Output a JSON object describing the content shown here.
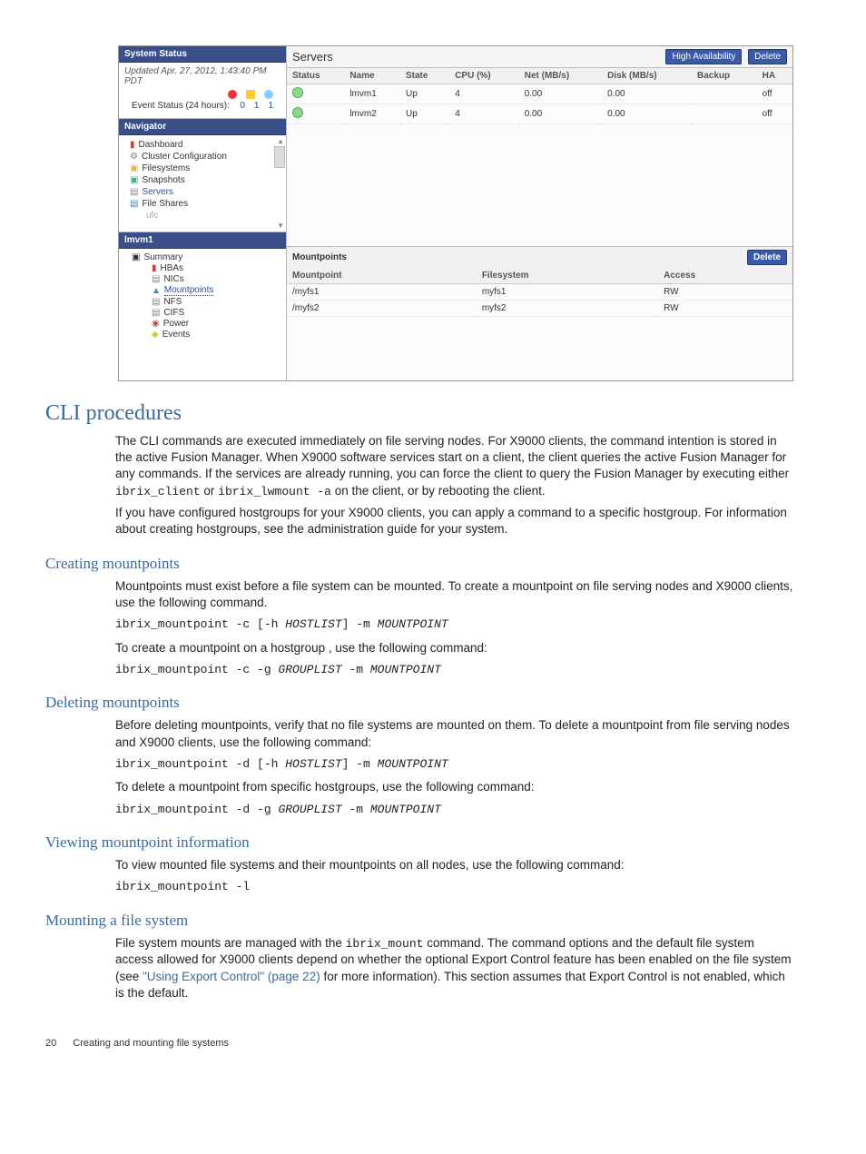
{
  "screenshot": {
    "system_status": {
      "title": "System Status",
      "updated": "Updated Apr. 27, 2012, 1:43:40 PM PDT",
      "event_label": "Event Status (24 hours):",
      "counts": [
        "0",
        "1",
        "1"
      ]
    },
    "navigator": {
      "title": "Navigator",
      "items": [
        "Dashboard",
        "Cluster Configuration",
        "Filesystems",
        "Snapshots",
        "Servers",
        "File Shares",
        "ufc"
      ]
    },
    "server_panel": {
      "title": "lmvm1",
      "summary": "Summary",
      "items": [
        "HBAs",
        "NICs",
        "Mountpoints",
        "NFS",
        "CIFS",
        "Power",
        "Events"
      ]
    },
    "servers": {
      "title": "Servers",
      "btn_ha": "High Availability",
      "btn_del": "Delete",
      "columns": [
        "Status",
        "Name",
        "State",
        "CPU (%)",
        "Net (MB/s)",
        "Disk (MB/s)",
        "Backup",
        "HA"
      ],
      "rows": [
        {
          "name": "lmvm1",
          "state": "Up",
          "cpu": "4",
          "net": "0.00",
          "disk": "0.00",
          "backup": "",
          "ha": "off"
        },
        {
          "name": "lmvm2",
          "state": "Up",
          "cpu": "4",
          "net": "0.00",
          "disk": "0.00",
          "backup": "",
          "ha": "off"
        }
      ]
    },
    "mountpoints": {
      "title": "Mountpoints",
      "btn_del": "Delete",
      "columns": [
        "Mountpoint",
        "Filesystem",
        "Access"
      ],
      "rows": [
        {
          "mp": "/myfs1",
          "fs": "myfs1",
          "access": "RW"
        },
        {
          "mp": "/myfs2",
          "fs": "myfs2",
          "access": "RW"
        }
      ]
    }
  },
  "doc": {
    "h1": "CLI procedures",
    "p1a": "The CLI commands are executed immediately on file serving nodes. For X9000 clients, the command intention is stored in the active Fusion Manager. When X9000 software services start on a client, the client queries the active Fusion Manager for any commands. If the services are already running, you can force the client to query the Fusion Manager by executing either ",
    "p1_code1": "ibrix_client",
    "p1b": " or ",
    "p1_code2": "ibrix_lwmount -a",
    "p1c": " on the client, or by rebooting the client.",
    "p2": "If you have configured hostgroups for your X9000 clients, you can apply a command to a specific hostgroup. For information about creating hostgroups, see the administration guide for your system.",
    "h2a": "Creating mountpoints",
    "p3": "Mountpoints must exist before a file system can be mounted. To create a mountpoint on file serving nodes and X9000 clients, use the following command.",
    "cmd1": "ibrix_mountpoint -c [-h HOSTLIST] -m MOUNTPOINT",
    "p4": "To create a mountpoint on a hostgroup , use the following command:",
    "cmd2": "ibrix_mountpoint -c -g GROUPLIST -m MOUNTPOINT",
    "h2b": "Deleting mountpoints",
    "p5": "Before deleting mountpoints, verify that no file systems are mounted on them. To delete a mountpoint from file serving nodes and X9000 clients, use the following command:",
    "cmd3": "ibrix_mountpoint -d [-h HOSTLIST] -m MOUNTPOINT",
    "p6": "To delete a mountpoint from specific hostgroups, use the following command:",
    "cmd4": "ibrix_mountpoint -d -g GROUPLIST -m MOUNTPOINT",
    "h2c": "Viewing mountpoint information",
    "p7": "To view mounted file systems and their mountpoints on all nodes, use the following command:",
    "cmd5": "ibrix_mountpoint -l",
    "h2d": "Mounting a file system",
    "p8a": "File system mounts are managed with the ",
    "p8_code": "ibrix_mount",
    "p8b": " command. The command options and the default file system access allowed for X9000 clients depend on whether the optional Export Control feature has been enabled on the file system (see ",
    "p8_link": "\"Using Export Control\" (page 22)",
    "p8c": " for more information). This section assumes that Export Control is not enabled, which is the default.",
    "footer_page": "20",
    "footer_title": "Creating and mounting file systems"
  }
}
